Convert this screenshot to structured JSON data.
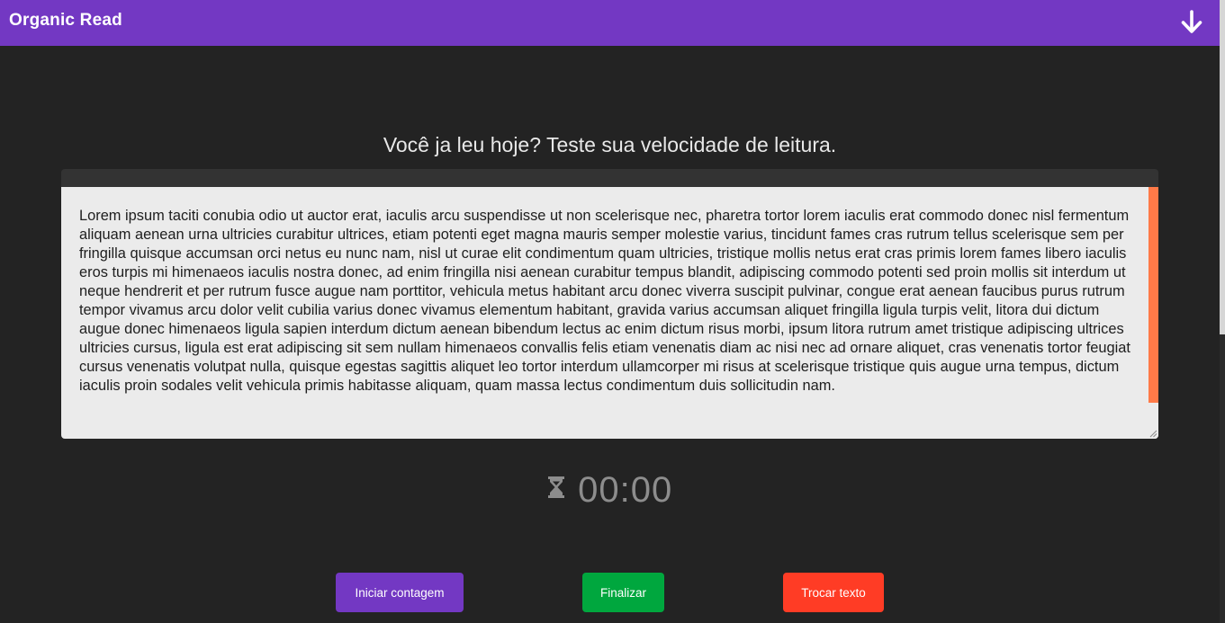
{
  "app": {
    "title": "Organic Read"
  },
  "header": {
    "download_icon": "arrow-down-icon"
  },
  "main": {
    "heading": "Você ja leu hoje? Teste sua velocidade de leitura.",
    "reading_text": "Lorem ipsum taciti conubia odio ut auctor erat, iaculis arcu suspendisse ut non scelerisque nec, pharetra tortor lorem iaculis erat commodo donec nisl fermentum aliquam aenean urna ultricies curabitur ultrices, etiam potenti eget magna mauris semper molestie varius, tincidunt fames cras rutrum tellus scelerisque sem per fringilla quisque accumsan orci netus eu nunc nam, nisl ut curae elit condimentum quam ultricies, tristique mollis netus erat cras primis lorem fames libero iaculis eros turpis mi himenaeos iaculis nostra donec, ad enim fringilla nisi aenean curabitur tempus blandit, adipiscing commodo potenti sed proin mollis sit interdum ut neque hendrerit et per rutrum fusce augue nam porttitor, vehicula metus habitant arcu donec viverra suscipit pulvinar, congue erat aenean faucibus purus rutrum tempor vivamus arcu dolor velit cubilia varius donec vivamus elementum habitant, gravida varius accumsan aliquet fringilla ligula turpis velit, litora dui dictum augue donec himenaeos ligula sapien interdum dictum aenean bibendum lectus ac enim dictum risus morbi, ipsum litora rutrum amet tristique adipiscing ultrices ultricies cursus, ligula est erat adipiscing sit sem nullam himenaeos convallis felis etiam venenatis diam ac nisi nec ad ornare aliquet, cras venenatis tortor feugiat cursus venenatis volutpat nulla, quisque egestas sagittis aliquet leo tortor interdum ullamcorper mi risus at scelerisque tristique quis augue urna tempus, dictum iaculis proin sodales velit vehicula primis habitasse aliquam, quam massa lectus condimentum duis sollicitudin nam."
  },
  "timer": {
    "icon": "hourglass-icon",
    "value": "00:00"
  },
  "actions": {
    "start_label": "Iniciar contagem",
    "finish_label": "Finalizar",
    "change_label": "Trocar texto"
  },
  "colors": {
    "primary": "#7338c3",
    "success": "#00a73e",
    "danger": "#ff3c25",
    "scroll_accent": "#ff7a48",
    "background": "#232323"
  }
}
